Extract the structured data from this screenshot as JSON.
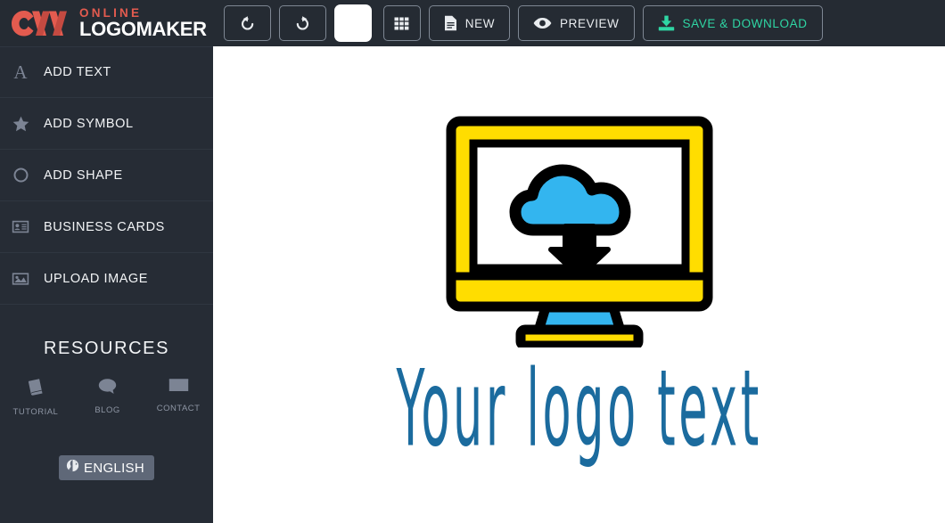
{
  "brand": {
    "line1": "ONLINE",
    "line2": "LOGOMAKER",
    "mark_icon": "om-monogram-icon",
    "accent_red": "#e35b4f",
    "text_white": "#ffffff"
  },
  "toolbar": {
    "undo": {
      "label": "",
      "icon": "undo-icon",
      "title": "Undo"
    },
    "redo": {
      "label": "",
      "icon": "redo-icon",
      "title": "Redo"
    },
    "color_swatch": {
      "label": "",
      "icon": "color-swatch-icon",
      "color": "#ffffff"
    },
    "grid": {
      "label": "",
      "icon": "grid-icon"
    },
    "new": {
      "label": "NEW",
      "icon": "document-icon"
    },
    "preview": {
      "label": "PREVIEW",
      "icon": "eye-icon"
    },
    "save_download": {
      "label": "SAVE & DOWNLOAD",
      "icon": "download-icon",
      "color": "#2fd6a4"
    }
  },
  "sidebar": {
    "items": [
      {
        "label": "ADD TEXT",
        "icon": "serif-a-icon"
      },
      {
        "label": "ADD SYMBOL",
        "icon": "star-icon"
      },
      {
        "label": "ADD SHAPE",
        "icon": "circle-outline-icon"
      },
      {
        "label": "BUSINESS CARDS",
        "icon": "id-card-icon"
      },
      {
        "label": "UPLOAD IMAGE",
        "icon": "image-icon"
      }
    ],
    "resources": {
      "title": "RESOURCES",
      "links": [
        {
          "label": "TUTORIAL",
          "icon": "book-icon"
        },
        {
          "label": "BLOG",
          "icon": "speech-bubble-icon"
        },
        {
          "label": "CONTACT",
          "icon": "envelope-icon"
        }
      ]
    },
    "language": {
      "label": "ENGLISH",
      "icon": "globe-icon"
    }
  },
  "canvas": {
    "background": "#ffffff",
    "logo_symbol": {
      "name": "cloud-download-monitor-icon",
      "frame_color": "#ffdd00",
      "cloud_color": "#33b5ef",
      "outline_color": "#000000",
      "screen_color": "#ffffff"
    },
    "logo_text": "Your logo text",
    "logo_text_color": "#1b6b9e"
  }
}
